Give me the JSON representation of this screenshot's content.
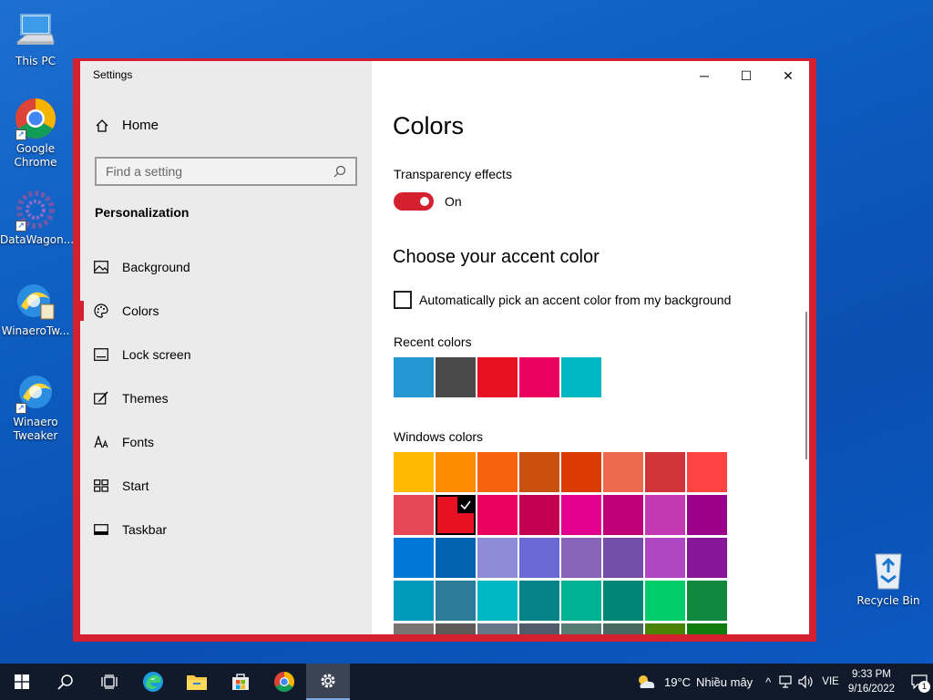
{
  "desktop": {
    "icons": [
      {
        "label": "This PC"
      },
      {
        "label": "Google Chrome"
      },
      {
        "label": "DataWagon..."
      },
      {
        "label": "WinaeroTw..."
      },
      {
        "label": "Winaero Tweaker"
      },
      {
        "label": "Recycle Bin"
      }
    ]
  },
  "window": {
    "app_title": "Settings",
    "controls": {
      "minimize": "─",
      "maximize": "☐",
      "close": "✕"
    },
    "accent_color": "#d5212f"
  },
  "sidebar": {
    "home_label": "Home",
    "search_placeholder": "Find a setting",
    "section_label": "Personalization",
    "items": [
      {
        "label": "Background",
        "icon": "picture-icon"
      },
      {
        "label": "Colors",
        "icon": "palette-icon",
        "active": true
      },
      {
        "label": "Lock screen",
        "icon": "lock-screen-icon"
      },
      {
        "label": "Themes",
        "icon": "brush-icon"
      },
      {
        "label": "Fonts",
        "icon": "fonts-icon"
      },
      {
        "label": "Start",
        "icon": "start-icon"
      },
      {
        "label": "Taskbar",
        "icon": "taskbar-icon"
      }
    ]
  },
  "main": {
    "title": "Colors",
    "transparency_label": "Transparency effects",
    "transparency_state": "On",
    "accent_heading": "Choose your accent color",
    "auto_pick_label": "Automatically pick an accent color from my background",
    "recent_label": "Recent colors",
    "recent_colors": [
      "#2596cf",
      "#4a4a4a",
      "#e81123",
      "#ea005e",
      "#00b7c3"
    ],
    "windows_colors_label": "Windows colors",
    "windows_colors": [
      "#ffb900",
      "#ff8c00",
      "#f7630c",
      "#ca5010",
      "#da3b01",
      "#ef6950",
      "#d13438",
      "#ff4343",
      "#e74856",
      "#e81123",
      "#ea005e",
      "#c30052",
      "#e3008c",
      "#bf0077",
      "#c239b3",
      "#9a0089",
      "#0078d7",
      "#0063b1",
      "#8e8cd8",
      "#6b69d6",
      "#8764b8",
      "#744da9",
      "#b146c2",
      "#881798",
      "#0099bc",
      "#2d7d9a",
      "#00b7c3",
      "#038387",
      "#00b294",
      "#018574",
      "#00cc6a",
      "#10893e",
      "#7a7574",
      "#5d5a58",
      "#68768a",
      "#515c6b",
      "#567c73",
      "#486860",
      "#498205",
      "#107c10"
    ],
    "selected_index": 9
  },
  "taskbar": {
    "weather_temp": "19°C",
    "weather_desc": "Nhiều mây",
    "language": "VIE",
    "time": "9:33 PM",
    "date": "9/16/2022",
    "notification_count": "1"
  }
}
